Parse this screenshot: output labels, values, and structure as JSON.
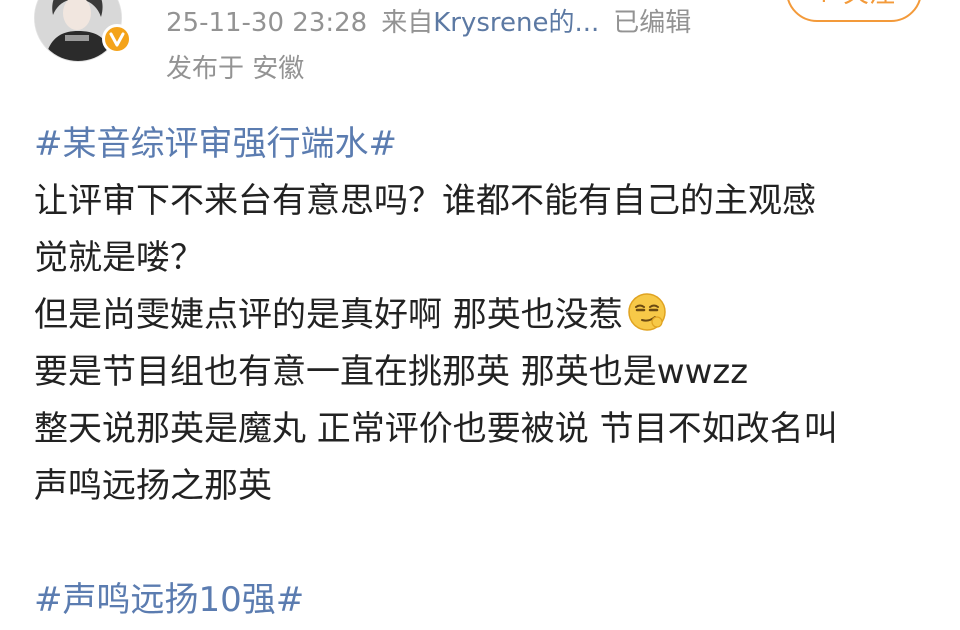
{
  "post": {
    "author": {
      "avatar_icon": "user-avatar-photo",
      "verified_icon": "verified-v-badge"
    },
    "timestamp": "25-11-30 23:28",
    "source_prefix": "来自",
    "source_name": "Krysrene的...",
    "edited_label": "已编辑",
    "location": "发布于 安徽",
    "follow_label": "+ 关注",
    "content": {
      "topic_1": "#某音综评审强行端水#",
      "line_1": "让评审下不来台有意思吗？谁都不能有自己的主观感",
      "line_2": "觉就是喽？",
      "line_3": "但是尚雯婕点评的是真好啊 那英也没惹",
      "line_3_emoji": "smirk-face-emoji",
      "line_4": "要是节目组也有意一直在挑那英 那英也是wwzz",
      "line_5": "整天说那英是魔丸 正常评价也要被说 节目不如改名叫",
      "line_6": "声鸣远扬之那英",
      "topic_2": "#声鸣远扬10强#"
    }
  },
  "colors": {
    "meta_gray": "#939393",
    "link_blue": "#5c79a3",
    "topic_blue": "#5b7cb0",
    "follow_orange": "#f39a3a",
    "verified_orange": "#f4a31a",
    "text": "#222222"
  }
}
